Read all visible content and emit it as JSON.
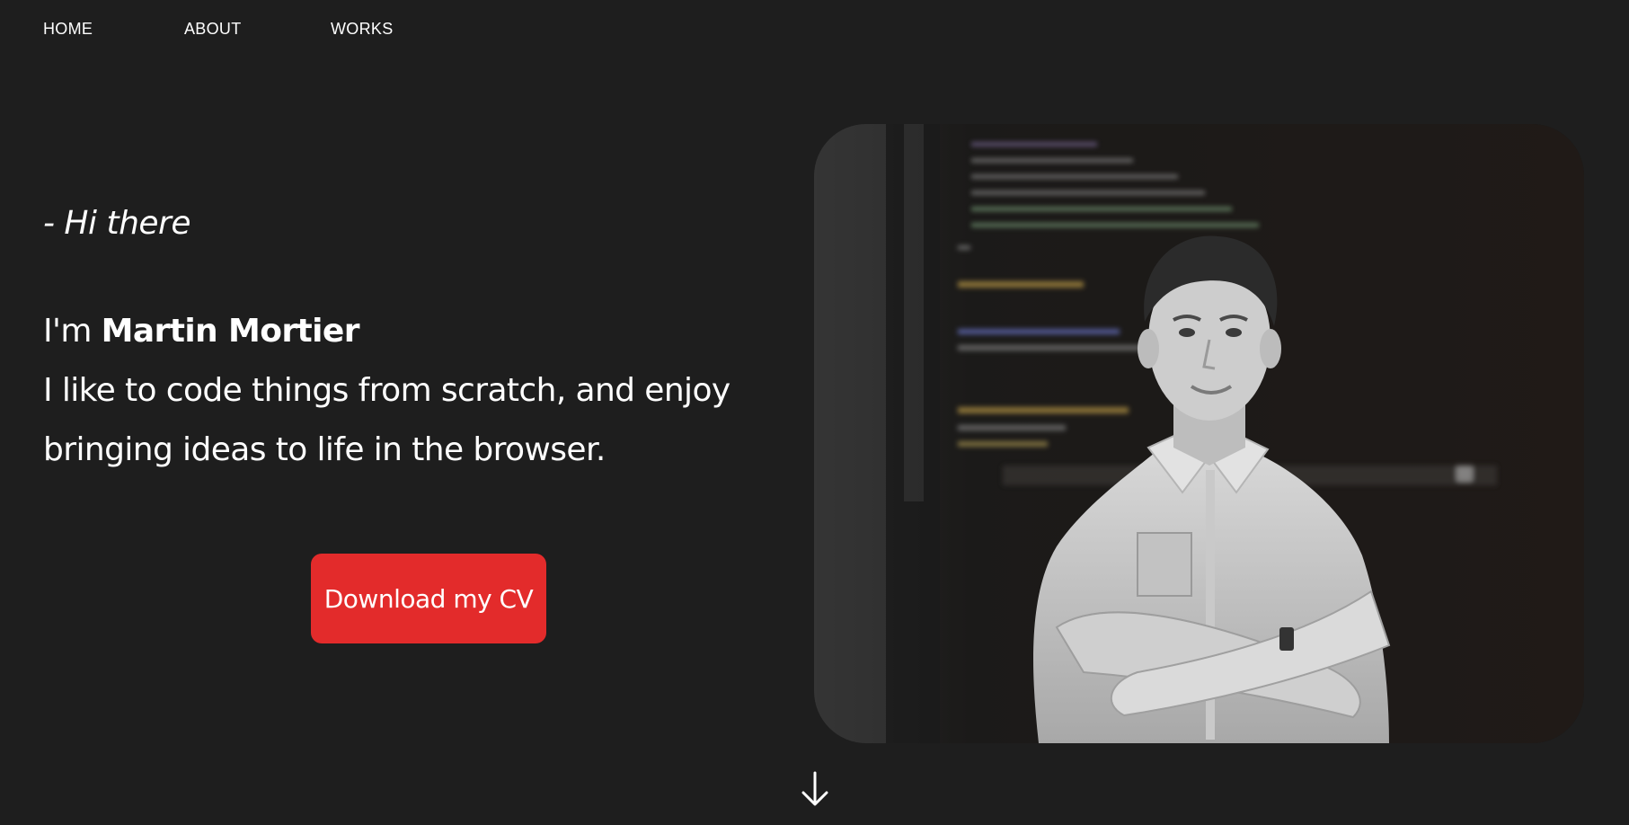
{
  "nav": {
    "items": [
      {
        "label": "HOME"
      },
      {
        "label": "ABOUT"
      },
      {
        "label": "WORKS"
      }
    ]
  },
  "hero": {
    "greeting": "- Hi there",
    "intro_prefix": "I'm ",
    "name": "Martin Mortier",
    "tagline": "I like to code things from scratch, and enjoy bringing ideas to life in the browser.",
    "cta_label": "Download my CV"
  },
  "colors": {
    "background": "#1e1e1e",
    "accent": "#e32b2b",
    "text": "#ffffff"
  },
  "icons": {
    "scroll_down": "arrow-down-icon"
  }
}
